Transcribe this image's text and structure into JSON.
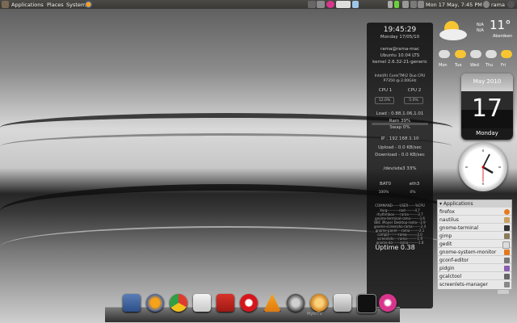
{
  "top_panel": {
    "menus": [
      "Applications",
      "Places",
      "System"
    ],
    "clock": "Mon 17 May,  7:45 PM",
    "user": "rama"
  },
  "sysinfo": {
    "time": "19:45:29",
    "date": "Monday 17/05/10",
    "host": "rama@rama-mac",
    "os": "Ubuntu 10.04 LTS",
    "kernel": "kernel 2.6.32-21-generic",
    "cpu_model": "Intel(R) Core(TM)2 Duo CPU",
    "cpu_model2": "P7350  @ 2.00GHz",
    "cpu1_label": "CPU 1",
    "cpu2_label": "CPU 2",
    "cpu1_value": "12.0%",
    "cpu2_value": "5.0%",
    "load": "Load : 0.88,1.06,1.01",
    "ram": "Ram 39%",
    "swap": "Swap 0%",
    "ip": "IP : 192.168.1.10",
    "upload": "Upload - 0.0 KB/sec",
    "download": "Download - 0.0 KB/sec",
    "disk": "/dev/sda3 33%",
    "bat_label": "BAT0",
    "eth_label": "eth3",
    "bat_value": "100%",
    "eth_value": "0%",
    "process_header": "COMMAND------USER------%CPU",
    "processes": [
      "Xorg----------root--------4.7",
      "rhythmbox-----rama--------3.7",
      "gnome-terminal-rama--------3.6",
      "BBC iPlayer Desktop-rama---2.9",
      "gnome-screensho-rama-------2.4",
      "gnome-panel----rama--------2.1",
      "compiz--------rama---------2.0",
      "screenlets----rama---------1.9",
      "gnome-do------rama---------1.8"
    ],
    "uptime": "Uptime 0.38"
  },
  "weather": {
    "temp": "11°",
    "city": "Aberdeen",
    "na1": "N/A",
    "na2": "N/A",
    "days": [
      "Mon",
      "Tue",
      "Wed",
      "Thu",
      "Fri"
    ]
  },
  "calendar": {
    "month": "May 2010",
    "day": "17",
    "weekday": "Monday"
  },
  "applications": {
    "title": "▾ Applications",
    "items": [
      "firefox",
      "nautilus",
      "gnome-terminal",
      "gimp",
      "gedit",
      "gnome-system-monitor",
      "gconf-editor",
      "pidgin",
      "gcalctool",
      "screenlets-manager"
    ]
  },
  "dock": {
    "label": "MythTV"
  }
}
